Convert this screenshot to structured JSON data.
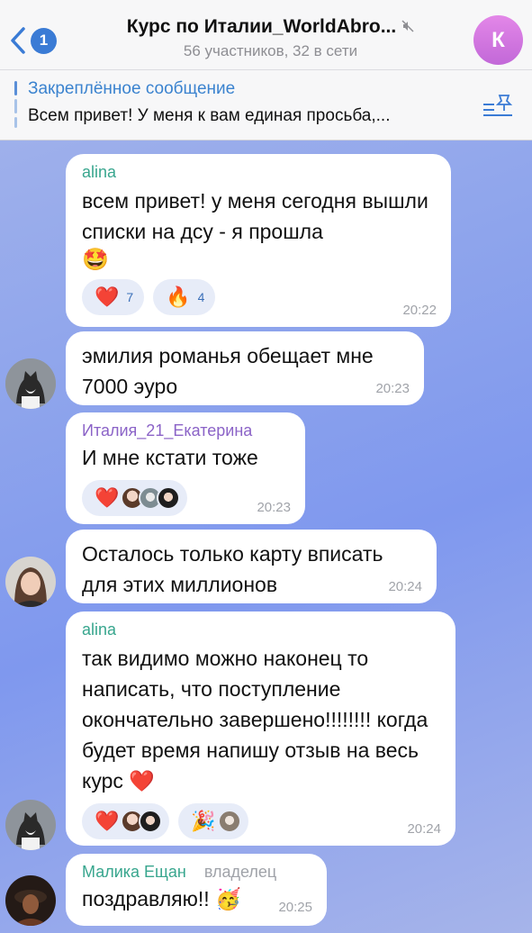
{
  "header": {
    "back_count": "1",
    "title": "Курс по Италии_WorldAbro...",
    "subtitle": "56 участников, 32 в сети",
    "avatar_letter": "К",
    "mute_icon": "muted-icon"
  },
  "pinned": {
    "title": "Закреплённое сообщение",
    "text": "Всем привет! У меня к вам единая просьба,...",
    "icon": "pinned-list-icon"
  },
  "messages": [
    {
      "sender": "alina",
      "sender_color": "#38a68e",
      "text": "всем привет! у меня сегодня вышли списки на дсу - я прошла",
      "emoji": "🤩",
      "time": "20:22",
      "reactions": [
        {
          "emoji": "❤️",
          "count": "7"
        },
        {
          "emoji": "🔥",
          "count": "4"
        }
      ]
    },
    {
      "text": "эмилия романья обещает мне 7000 эуро",
      "time": "20:23"
    },
    {
      "sender": "Италия_21_Екатерина",
      "sender_color": "#8b63c7",
      "text": "И мне кстати тоже",
      "time": "20:23",
      "reactions": [
        {
          "emoji": "❤️"
        }
      ]
    },
    {
      "text": "Осталось только карту вписать для  этих миллионов",
      "time": "20:24"
    },
    {
      "sender": "alina",
      "sender_color": "#38a68e",
      "text": "так видимо можно наконец то написать, что поступление окончательно завершено!!!!!!!! когда будет время напишу отзыв на весь курс ❤️",
      "time": "20:24",
      "reactions": [
        {
          "emoji": "❤️"
        },
        {
          "emoji": "🎉"
        }
      ]
    },
    {
      "sender": "Малика Ещан",
      "sender_color": "#38a68e",
      "sender_role": "владелец",
      "text": "поздравляю!! 🥳",
      "time": "20:25"
    }
  ],
  "colors": {
    "accent": "#3a7bd5",
    "header_bg": "#f7f7f8",
    "reaction_bg": "#e7ecf8"
  }
}
